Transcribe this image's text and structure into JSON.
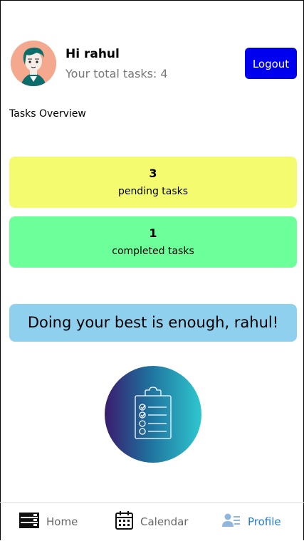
{
  "header": {
    "greeting": "Hi rahul",
    "total_tasks_text": "Your total tasks: 4",
    "logout_label": "Logout",
    "avatar_icon": "user-avatar-icon"
  },
  "overview": {
    "title": "Tasks Overview",
    "pending": {
      "count": "3",
      "label": "pending tasks",
      "color": "#f5fb6e"
    },
    "completed": {
      "count": "1",
      "label": "completed tasks",
      "color": "#6cff9a"
    }
  },
  "quote": {
    "text": "Doing your best is enough, rahul!",
    "color": "#8fd0ef"
  },
  "illustration": {
    "icon": "clipboard-checklist-icon"
  },
  "nav": {
    "items": [
      {
        "label": "Home",
        "icon": "home-icon",
        "active": false
      },
      {
        "label": "Calendar",
        "icon": "calendar-icon",
        "active": false
      },
      {
        "label": "Profile",
        "icon": "profile-icon",
        "active": true
      }
    ],
    "active_color": "#1f7cd6"
  },
  "colors": {
    "logout_bg": "#0000ee"
  }
}
